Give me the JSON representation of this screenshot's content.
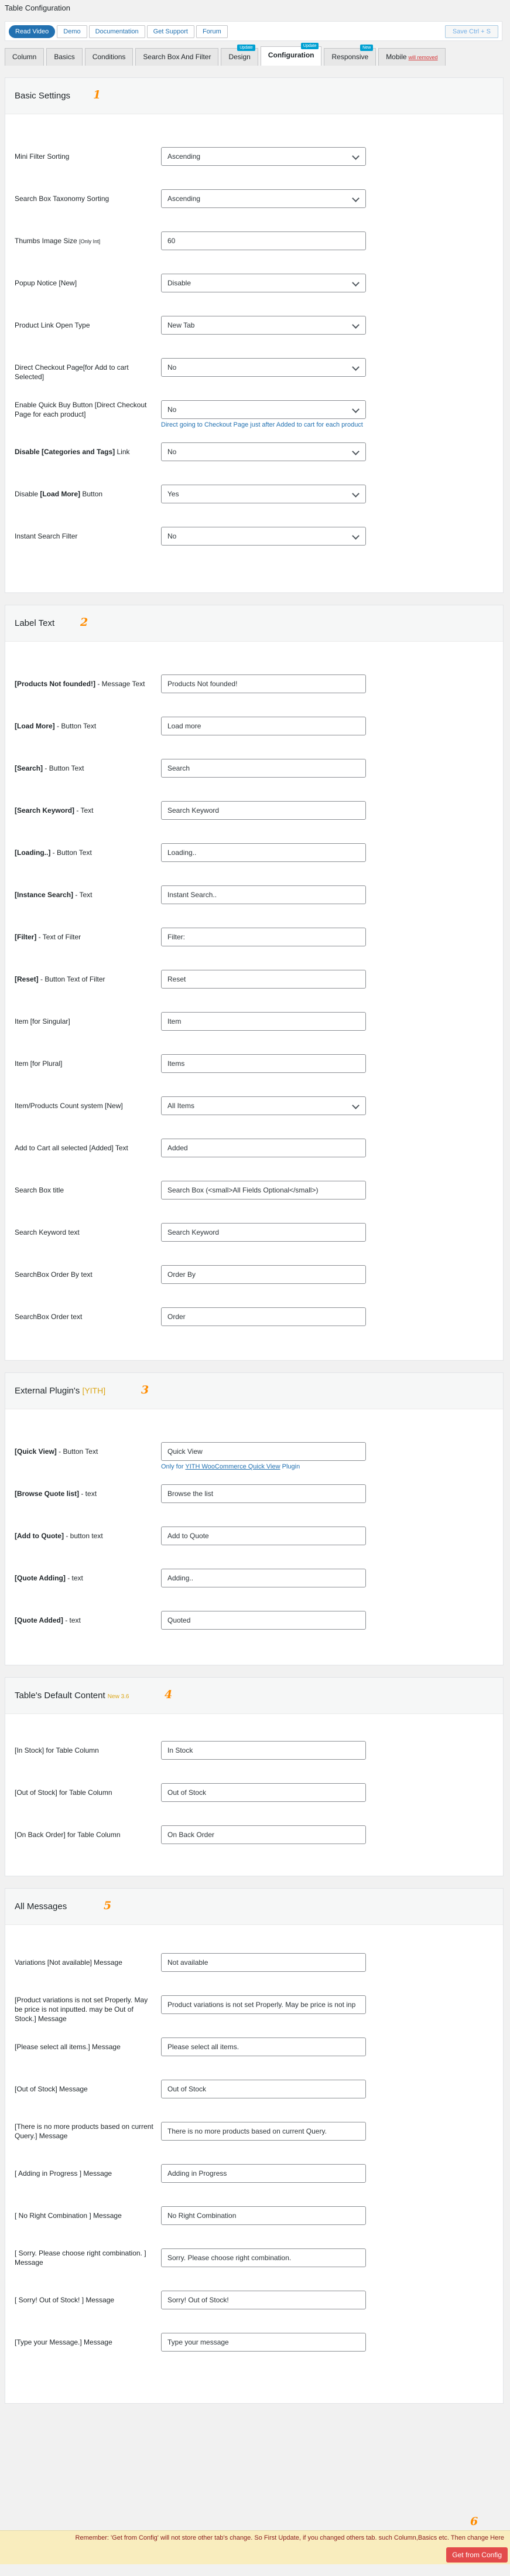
{
  "page_title": "Table Configuration",
  "topbar": {
    "links": [
      "Read Video",
      "Demo",
      "Documentation",
      "Get Support",
      "Forum"
    ],
    "save_label": "Save Ctrl + S"
  },
  "tabs": [
    {
      "label": "Column",
      "badge": "",
      "pro": ""
    },
    {
      "label": "Basics",
      "badge": "",
      "pro": ""
    },
    {
      "label": "Conditions",
      "badge": "",
      "pro": ""
    },
    {
      "label": "Search Box And Filter",
      "badge": "",
      "pro": ""
    },
    {
      "label": "Design",
      "badge": "Update",
      "pro": ""
    },
    {
      "label": "Configuration",
      "badge": "Update",
      "pro": ""
    },
    {
      "label": "Responsive",
      "badge": "New",
      "pro": ""
    },
    {
      "label": "Mobile",
      "badge": "",
      "pro": "will removed"
    }
  ],
  "sections": {
    "basic": {
      "title": "Basic Settings",
      "number": "1",
      "rows": [
        {
          "label": "Mini Filter Sorting",
          "value": "Ascending"
        },
        {
          "label": "Search Box Taxonomy Sorting",
          "value": "Ascending"
        },
        {
          "label": "Thumbs Image Size",
          "label_small": "[Only Int]",
          "value": "60"
        },
        {
          "label": "Popup Notice [New]",
          "value": "Disable"
        },
        {
          "label": "Product Link Open Type",
          "value": "New Tab"
        },
        {
          "label": "Direct Checkout Page[for Add to cart Selected]",
          "value": "No"
        },
        {
          "label": "Enable Quick Buy Button [Direct Checkout Page for each product]",
          "value": "No",
          "help": "Direct going to Checkout Page just after Added to cart for each product"
        },
        {
          "label_bold": "Disable [Categories and Tags]",
          "label": " Link",
          "value": "No"
        },
        {
          "label": "Disable ",
          "label_bold_after": "[Load More]",
          "label_after": " Button",
          "value": "Yes"
        },
        {
          "label": "Instant Search Filter",
          "value": "No"
        }
      ]
    },
    "label_text": {
      "title": "Label Text",
      "number": "2",
      "rows": [
        {
          "bold": "[Products Not founded!]",
          "rest": " - Message Text",
          "value": "Products Not founded!"
        },
        {
          "bold": "[Load More]",
          "rest": " - Button Text",
          "value": "Load more"
        },
        {
          "bold": "[Search]",
          "rest": " - Button Text",
          "value": "Search"
        },
        {
          "bold": "[Search Keyword]",
          "rest": " - Text",
          "value": "Search Keyword"
        },
        {
          "bold": "[Loading..]",
          "rest": " - Button Text",
          "value": "Loading.."
        },
        {
          "bold": "[Instance Search]",
          "rest": " - Text",
          "value": "Instant Search.."
        },
        {
          "bold": "[Filter]",
          "rest": " - Text of Filter",
          "value": "Filter:"
        },
        {
          "bold": "[Reset]",
          "rest": " - Button Text of Filter",
          "value": "Reset"
        },
        {
          "bold": "",
          "rest": "Item [for Singular]",
          "value": "Item"
        },
        {
          "bold": "",
          "rest": "Item [for Plural]",
          "value": "Items"
        },
        {
          "bold": "",
          "rest": "Item/Products Count system [New]",
          "value": "All Items",
          "select": true
        },
        {
          "bold": "",
          "rest": "Add to Cart all selected [Added] Text",
          "value": "Added"
        },
        {
          "bold": "",
          "rest": "Search Box title",
          "value": "Search Box (<small>All Fields Optional</small>)"
        },
        {
          "bold": "",
          "rest": "Search Keyword text",
          "value": "Search Keyword"
        },
        {
          "bold": "",
          "rest": "SearchBox Order By text",
          "value": "Order By"
        },
        {
          "bold": "",
          "rest": "SearchBox Order text",
          "value": "Order"
        }
      ]
    },
    "external": {
      "title": "External Plugin's",
      "title_sub": "[YITH]",
      "number": "3",
      "rows": [
        {
          "bold": "[Quick View]",
          "rest": " - Button Text",
          "value": "Quick View",
          "help_pre": "Only for ",
          "help_link": "YITH WooCommerce Quick View",
          "help_post": " Plugin"
        },
        {
          "bold": "[Browse Quote list]",
          "rest": " - text",
          "value": "Browse the list"
        },
        {
          "bold": "[Add to Quote]",
          "rest": " - button text",
          "value": "Add to Quote"
        },
        {
          "bold": "[Quote Adding]",
          "rest": " - text",
          "value": "Adding.."
        },
        {
          "bold": "[Quote Added]",
          "rest": " - text",
          "value": "Quoted"
        }
      ]
    },
    "default_content": {
      "title": "Table's Default Content",
      "title_tiny": "New 3.6",
      "number": "4",
      "rows": [
        {
          "label": "[In Stock] for Table Column",
          "value": "In Stock"
        },
        {
          "label": "[Out of Stock] for Table Column",
          "value": "Out of Stock"
        },
        {
          "label": "[On Back Order] for Table Column",
          "value": "On Back Order"
        }
      ]
    },
    "messages": {
      "title": "All Messages",
      "number": "5",
      "rows": [
        {
          "label": "Variations [Not available] Message",
          "value": "Not available"
        },
        {
          "label": "[Product variations is not set Properly. May be price is not inputted. may be Out of Stock.] Message",
          "value": "Product variations is not set Properly. May be price is not inp"
        },
        {
          "label": "[Please select all items.] Message",
          "value": "Please select all items."
        },
        {
          "label": "[Out of Stock] Message",
          "value": "Out of Stock"
        },
        {
          "label": "[There is no more products based on current Query.] Message",
          "value": "There is no more products based on current Query."
        },
        {
          "label": "[ Adding in Progress ] Message",
          "value": "Adding in Progress"
        },
        {
          "label": "[ No Right Combination ] Message",
          "value": "No Right Combination"
        },
        {
          "label": "[ Sorry. Please choose right combination. ] Message",
          "value": "Sorry. Please choose right combination."
        },
        {
          "label": "[ Sorry! Out of Stock! ] Message",
          "value": "Sorry! Out of Stock!"
        },
        {
          "label": "[Type your Message.] Message",
          "value": "Type your message"
        }
      ]
    }
  },
  "footer": {
    "number": "6",
    "note": "Remember: 'Get from Config' will not store other tab's change. So First Update, if you changed others tab. such Column,Basics etc. Then change Here",
    "button": "Get from Config"
  },
  "colors": {
    "accent": "#2271b1",
    "number_marker": "#ff8c00",
    "footer_bg": "#f9edbe",
    "footer_button": "#e34b4b"
  }
}
